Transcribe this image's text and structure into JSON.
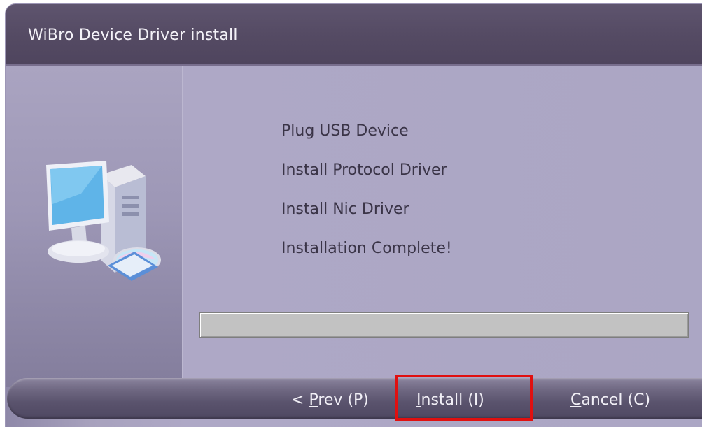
{
  "window": {
    "title": "WiBro Device Driver install"
  },
  "steps": [
    "Plug USB Device",
    "Install Protocol Driver",
    "Install Nic Driver",
    "Installation Complete!"
  ],
  "progress": {
    "value": 0
  },
  "buttons": {
    "prev": {
      "prefix": "< ",
      "mnemonic": "P",
      "rest": "rev (P)"
    },
    "install": {
      "prefix": "",
      "mnemonic": "I",
      "rest": "nstall (I)"
    },
    "cancel": {
      "prefix": "",
      "mnemonic": "C",
      "rest": "ancel (C)"
    }
  },
  "icons": {
    "left_panel": "computer-cd-icon"
  },
  "colors": {
    "title_bar": "#544a63",
    "highlight": "#e01010",
    "progress_track": "#c2c2c2"
  }
}
